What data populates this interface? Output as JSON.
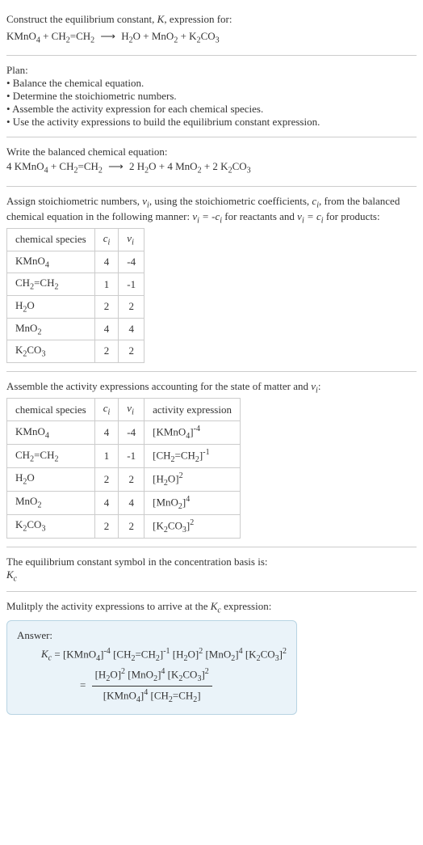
{
  "intro": {
    "line1": "Construct the equilibrium constant, ",
    "k": "K",
    "line1b": ", expression for:",
    "eq": "KMnO₄ + CH₂=CH₂ ⟶ H₂O + MnO₂ + K₂CO₃"
  },
  "plan": {
    "heading": "Plan:",
    "items": [
      "• Balance the chemical equation.",
      "• Determine the stoichiometric numbers.",
      "• Assemble the activity expression for each chemical species.",
      "• Use the activity expressions to build the equilibrium constant expression."
    ]
  },
  "balanced": {
    "heading": "Write the balanced chemical equation:",
    "eq": "4 KMnO₄ + CH₂=CH₂ ⟶ 2 H₂O + 4 MnO₂ + 2 K₂CO₃"
  },
  "assign": {
    "text1": "Assign stoichiometric numbers, ",
    "nu": "νᵢ",
    "text2": ", using the stoichiometric coefficients, ",
    "ci": "cᵢ",
    "text3": ", from the balanced chemical equation in the following manner: ",
    "rel1": "νᵢ = -cᵢ",
    "text4": " for reactants and ",
    "rel2": "νᵢ = cᵢ",
    "text5": " for products:"
  },
  "table1": {
    "headers": [
      "chemical species",
      "cᵢ",
      "νᵢ"
    ],
    "rows": [
      [
        "KMnO₄",
        "4",
        "-4"
      ],
      [
        "CH₂=CH₂",
        "1",
        "-1"
      ],
      [
        "H₂O",
        "2",
        "2"
      ],
      [
        "MnO₂",
        "4",
        "4"
      ],
      [
        "K₂CO₃",
        "2",
        "2"
      ]
    ]
  },
  "assemble": {
    "text1": "Assemble the activity expressions accounting for the state of matter and ",
    "nu": "νᵢ",
    "text2": ":"
  },
  "table2": {
    "headers": [
      "chemical species",
      "cᵢ",
      "νᵢ",
      "activity expression"
    ],
    "rows": [
      {
        "sp": "KMnO₄",
        "c": "4",
        "n": "-4",
        "base": "[KMnO₄]",
        "exp": "-4"
      },
      {
        "sp": "CH₂=CH₂",
        "c": "1",
        "n": "-1",
        "base": "[CH₂=CH₂]",
        "exp": "-1"
      },
      {
        "sp": "H₂O",
        "c": "2",
        "n": "2",
        "base": "[H₂O]",
        "exp": "2"
      },
      {
        "sp": "MnO₂",
        "c": "4",
        "n": "4",
        "base": "[MnO₂]",
        "exp": "4"
      },
      {
        "sp": "K₂CO₃",
        "c": "2",
        "n": "2",
        "base": "[K₂CO₃]",
        "exp": "2"
      }
    ]
  },
  "symbol": {
    "line1": "The equilibrium constant symbol in the concentration basis is:",
    "kc": "K꜀"
  },
  "multiply": {
    "text1": "Mulitply the activity expressions to arrive at the ",
    "kc": "K꜀",
    "text2": " expression:"
  },
  "answer": {
    "label": "Answer:",
    "kc": "K꜀",
    "eq": " = ",
    "flat": [
      {
        "b": "[KMnO₄]",
        "e": "-4"
      },
      {
        "b": " [CH₂=CH₂]",
        "e": "-1"
      },
      {
        "b": " [H₂O]",
        "e": "2"
      },
      {
        "b": " [MnO₂]",
        "e": "4"
      },
      {
        "b": " [K₂CO₃]",
        "e": "2"
      }
    ],
    "num": [
      {
        "b": "[H₂O]",
        "e": "2"
      },
      {
        "b": " [MnO₂]",
        "e": "4"
      },
      {
        "b": " [K₂CO₃]",
        "e": "2"
      }
    ],
    "den": [
      {
        "b": "[KMnO₄]",
        "e": "4"
      },
      {
        "b": " [CH₂=CH₂]",
        "e": ""
      }
    ]
  }
}
